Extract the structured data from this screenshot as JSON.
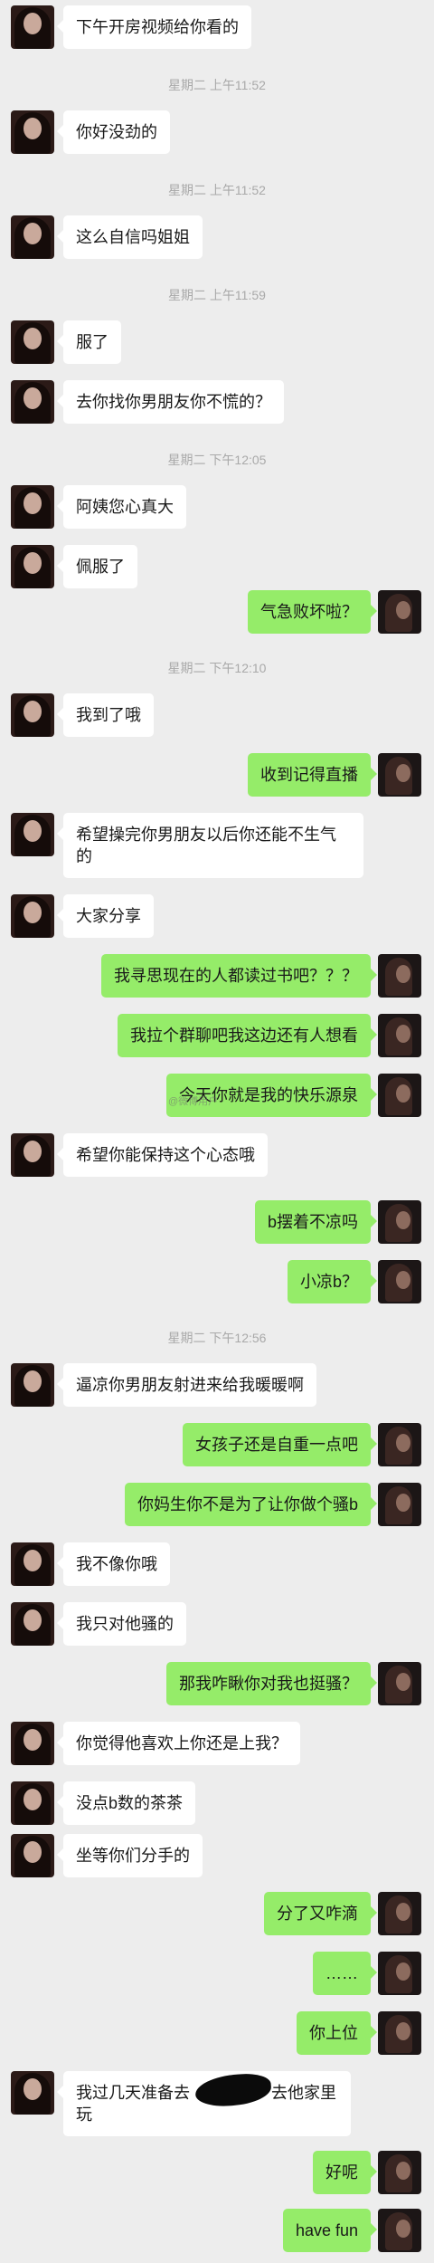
{
  "colors": {
    "background": "#ededed",
    "incoming_bubble": "#ffffff",
    "outgoing_bubble": "#95ec69",
    "timestamp_text": "#a9a9a9"
  },
  "timestamps": [
    "星期二 上午11:52",
    "星期二 上午11:52",
    "星期二 上午11:59",
    "星期二 下午12:05",
    "星期二 下午12:10",
    "星期二 下午12:56"
  ],
  "watermark": "@微博用户",
  "messages": [
    {
      "side": "left",
      "text": "下午开房视频给你看的"
    },
    {
      "side": "left",
      "text": "你好没劲的"
    },
    {
      "side": "left",
      "text": "这么自信吗姐姐"
    },
    {
      "side": "left",
      "text": "服了"
    },
    {
      "side": "left",
      "text": "去你找你男朋友你不慌的？"
    },
    {
      "side": "left",
      "text": "阿姨您心真大"
    },
    {
      "side": "left",
      "text": "佩服了"
    },
    {
      "side": "right",
      "text": "气急败坏啦？"
    },
    {
      "side": "left",
      "text": "我到了哦"
    },
    {
      "side": "right",
      "text": "收到记得直播"
    },
    {
      "side": "left",
      "text": "希望操完你男朋友以后你还能不生气的"
    },
    {
      "side": "left",
      "text": "大家分享"
    },
    {
      "side": "right",
      "text": "我寻思现在的人都读过书吧？？？"
    },
    {
      "side": "right",
      "text": "我拉个群聊吧我这边还有人想看"
    },
    {
      "side": "right",
      "text": "今天你就是我的快乐源泉"
    },
    {
      "side": "left",
      "text": "希望你能保持这个心态哦"
    },
    {
      "side": "right",
      "text": "b摆着不凉吗"
    },
    {
      "side": "right",
      "text": "小凉b？"
    },
    {
      "side": "left",
      "text": "逼凉你男朋友射进来给我暖暖啊"
    },
    {
      "side": "right",
      "text": "女孩子还是自重一点吧"
    },
    {
      "side": "right",
      "text": "你妈生你不是为了让你做个骚b"
    },
    {
      "side": "left",
      "text": "我不像你哦"
    },
    {
      "side": "left",
      "text": "我只对他骚的"
    },
    {
      "side": "right",
      "text": "那我咋瞅你对我也挺骚？"
    },
    {
      "side": "left",
      "text": "你觉得他喜欢上你还是上我？"
    },
    {
      "side": "left",
      "text": "没点b数的茶茶"
    },
    {
      "side": "left",
      "text": "坐等你们分手的"
    },
    {
      "side": "right",
      "text": "分了又咋滴"
    },
    {
      "side": "right",
      "text": "……"
    },
    {
      "side": "right",
      "text": "你上位"
    },
    {
      "side": "left",
      "text": "我过几天准备去　　　　　去他家里玩"
    },
    {
      "side": "right",
      "text": "好呢"
    },
    {
      "side": "right",
      "text": "have fun"
    }
  ]
}
